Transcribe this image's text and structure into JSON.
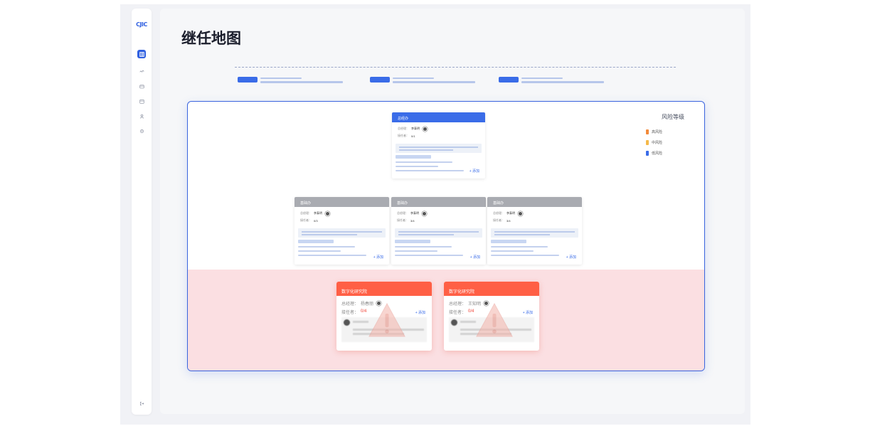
{
  "app": {
    "logo": "CJIC"
  },
  "sidebar": {
    "items": [
      {
        "icon": "map-icon",
        "active": true
      },
      {
        "icon": "trend-icon",
        "active": false
      },
      {
        "icon": "folder-icon",
        "active": false
      },
      {
        "icon": "calendar-icon",
        "active": false
      },
      {
        "icon": "user-icon",
        "active": false
      },
      {
        "icon": "settings-icon",
        "active": false
      }
    ],
    "logout_icon": "logout-icon"
  },
  "page": {
    "title": "继任地图"
  },
  "legend": {
    "title": "风险等级",
    "items": [
      {
        "label": "高风险",
        "color": "#f28a3a"
      },
      {
        "label": "中风险",
        "color": "#f5b94a"
      },
      {
        "label": "低风险",
        "color": "#3a6ce8"
      }
    ]
  },
  "top_card": {
    "title": "总经办",
    "manager_label": "总经理：",
    "manager_name": "李泰明",
    "successor_label": "接任者：",
    "successor_value": "0/1",
    "add_label": "+ 添加"
  },
  "mid_cards": [
    {
      "title": "基础办",
      "manager_label": "总经理：",
      "manager_name": "李泰明",
      "successor_label": "接任者：",
      "successor_value": "0/3",
      "add_label": "+ 添加"
    },
    {
      "title": "基础办",
      "manager_label": "总经理：",
      "manager_name": "李泰明",
      "successor_label": "接任者：",
      "successor_value": "3/4",
      "add_label": "+ 添加"
    },
    {
      "title": "基础办",
      "manager_label": "总经理：",
      "manager_name": "李泰明",
      "successor_label": "接任者：",
      "successor_value": "3/4",
      "add_label": "+ 添加"
    }
  ],
  "risk_cards": [
    {
      "title": "数字化研究院",
      "manager_label": "总经理：",
      "manager_name": "杨春丽",
      "successor_label": "接任者：",
      "successor_value": "0/4",
      "add_label": "+ 添加"
    },
    {
      "title": "数字化研究院",
      "manager_label": "总经理：",
      "manager_name": "王知明",
      "successor_label": "接任者：",
      "successor_value": "0/4",
      "add_label": "+ 添加"
    }
  ]
}
